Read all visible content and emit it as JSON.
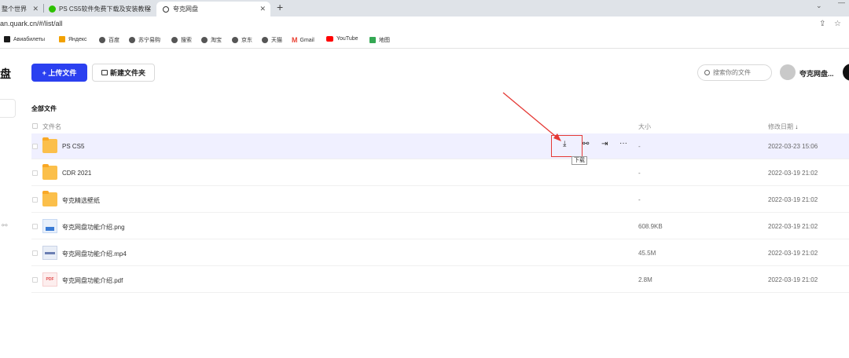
{
  "browser": {
    "tabs": [
      {
        "label": "整个世界",
        "active": false
      },
      {
        "label": "PS CS5软件免费下载及安装教程",
        "active": false
      },
      {
        "label": "夸克网盘",
        "active": true
      }
    ],
    "close_glyph": "✕",
    "new_tab_glyph": "+",
    "window_controls": {
      "collapse": "⌄",
      "minimize": "—"
    },
    "url": "an.quark.cn/#/list/all",
    "bookmarks": [
      {
        "label": "Авиабилеты",
        "icon_color": "#1a1a1a"
      },
      {
        "label": "Яндекс",
        "icon_color": "#f2a100"
      },
      {
        "label": "百度",
        "icon_color": "#555555"
      },
      {
        "label": "苏宁易购",
        "icon_color": "#555555"
      },
      {
        "label": "搜索",
        "icon_color": "#555555"
      },
      {
        "label": "淘宝",
        "icon_color": "#555555"
      },
      {
        "label": "京东",
        "icon_color": "#555555"
      },
      {
        "label": "天猫",
        "icon_color": "#555555"
      },
      {
        "label": "Gmail",
        "icon_color": "#ea4335"
      },
      {
        "label": "YouTube",
        "icon_color": "#ff0000"
      },
      {
        "label": "地图",
        "icon_color": "#34a853"
      }
    ]
  },
  "app": {
    "logo_text": "盘",
    "upload_label": "+ 上传文件",
    "newfolder_label": "新建文件夹",
    "search_placeholder": "搜索你的文件",
    "username": "夸克网盘...",
    "breadcrumb": "全部文件",
    "columns": {
      "name": "文件名",
      "size": "大小",
      "date": "修改日期"
    },
    "sort_indicator": "↓",
    "tooltip": "下载",
    "accent": "#2b40f0",
    "files": [
      {
        "name": "PS CS5",
        "type": "folder",
        "size": "-",
        "date": "2022-03-23 15:06"
      },
      {
        "name": "CDR 2021",
        "type": "folder",
        "size": "-",
        "date": "2022-03-19 21:02"
      },
      {
        "name": "夸克精选壁纸",
        "type": "folder",
        "size": "-",
        "date": "2022-03-19 21:02"
      },
      {
        "name": "夸克网盘功能介绍.png",
        "type": "image",
        "size": "608.9KB",
        "date": "2022-03-19 21:02"
      },
      {
        "name": "夸克网盘功能介绍.mp4",
        "type": "video",
        "size": "45.5M",
        "date": "2022-03-19 21:02"
      },
      {
        "name": "夸克网盘功能介绍.pdf",
        "type": "pdf",
        "size": "2.8M",
        "date": "2022-03-19 21:02",
        "icon_text": "PDF"
      }
    ]
  }
}
